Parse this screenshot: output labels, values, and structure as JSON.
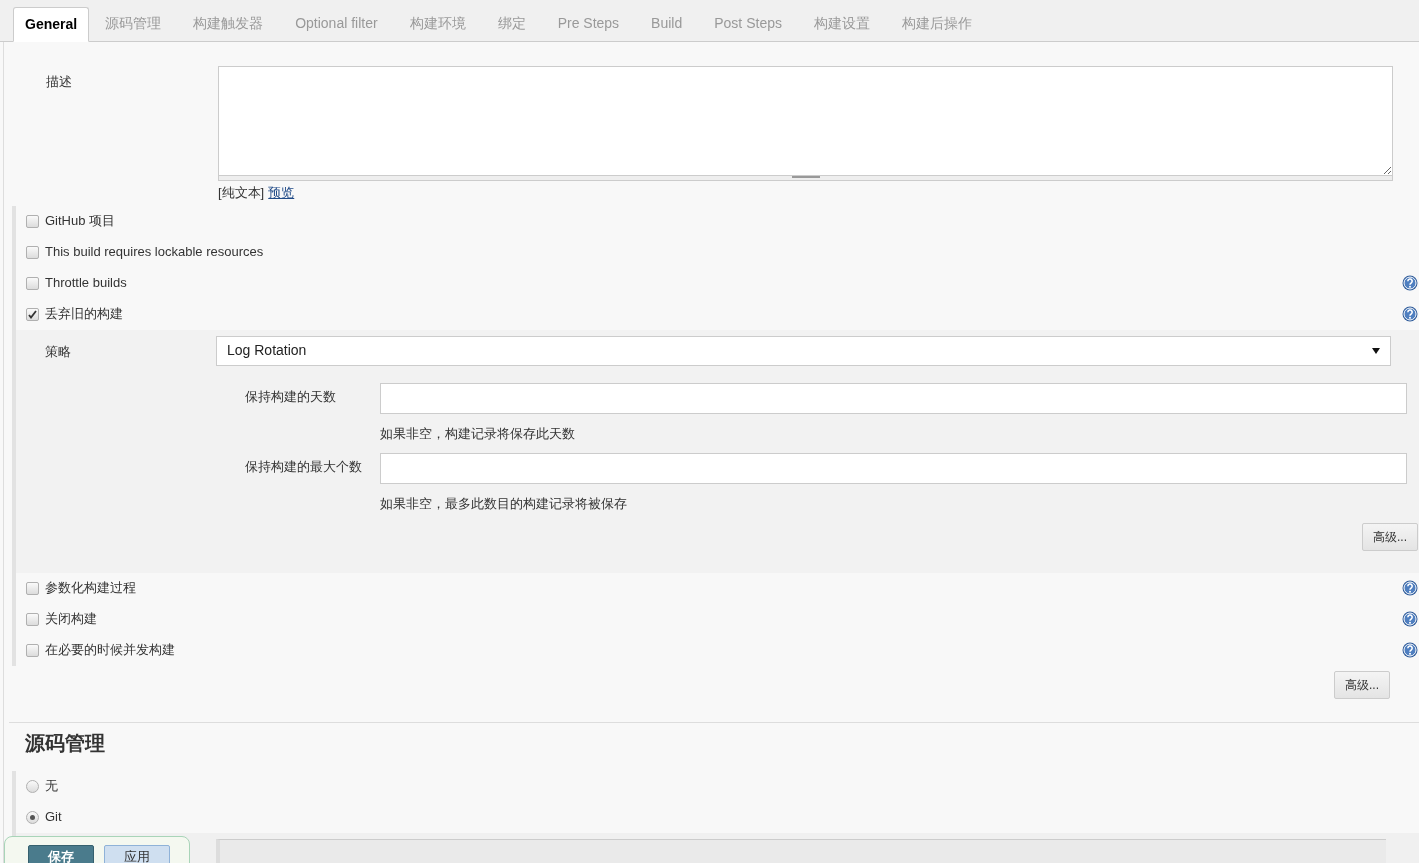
{
  "tabs": [
    {
      "label": "General",
      "selected": true
    },
    {
      "label": "源码管理",
      "selected": false
    },
    {
      "label": "构建触发器",
      "selected": false
    },
    {
      "label": "Optional filter",
      "selected": false
    },
    {
      "label": "构建环境",
      "selected": false
    },
    {
      "label": "绑定",
      "selected": false
    },
    {
      "label": "Pre Steps",
      "selected": false
    },
    {
      "label": "Build",
      "selected": false
    },
    {
      "label": "Post Steps",
      "selected": false
    },
    {
      "label": "构建设置",
      "selected": false
    },
    {
      "label": "构建后操作",
      "selected": false
    }
  ],
  "description": {
    "label": "描述",
    "format_label": "[纯文本]",
    "preview_link": "预览"
  },
  "options": [
    {
      "label": "GitHub 项目",
      "checked": false,
      "help": false
    },
    {
      "label": "This build requires lockable resources",
      "checked": false,
      "help": false
    },
    {
      "label": "Throttle builds",
      "checked": false,
      "help": true
    },
    {
      "label": "丢弃旧的构建",
      "checked": true,
      "help": true,
      "details": {
        "strategy_label": "策略",
        "strategy_value": "Log Rotation",
        "fields": [
          {
            "label": "保持构建的天数",
            "hint": "如果非空，构建记录将保存此天数"
          },
          {
            "label": "保持构建的最大个数",
            "hint": "如果非空，最多此数目的构建记录将被保存"
          }
        ],
        "advanced_button": "高级..."
      }
    },
    {
      "label": "参数化构建过程",
      "checked": false,
      "help": true
    },
    {
      "label": "关闭构建",
      "checked": false,
      "help": true
    },
    {
      "label": "在必要的时候并发构建",
      "checked": false,
      "help": true
    }
  ],
  "advanced_button": "高级...",
  "scm": {
    "heading": "源码管理",
    "options": [
      {
        "label": "无",
        "selected": false
      },
      {
        "label": "Git",
        "selected": true
      }
    ]
  },
  "footer_buttons": [
    {
      "label": "保存",
      "kind": "primary"
    },
    {
      "label": "应用",
      "kind": "secondary"
    }
  ]
}
